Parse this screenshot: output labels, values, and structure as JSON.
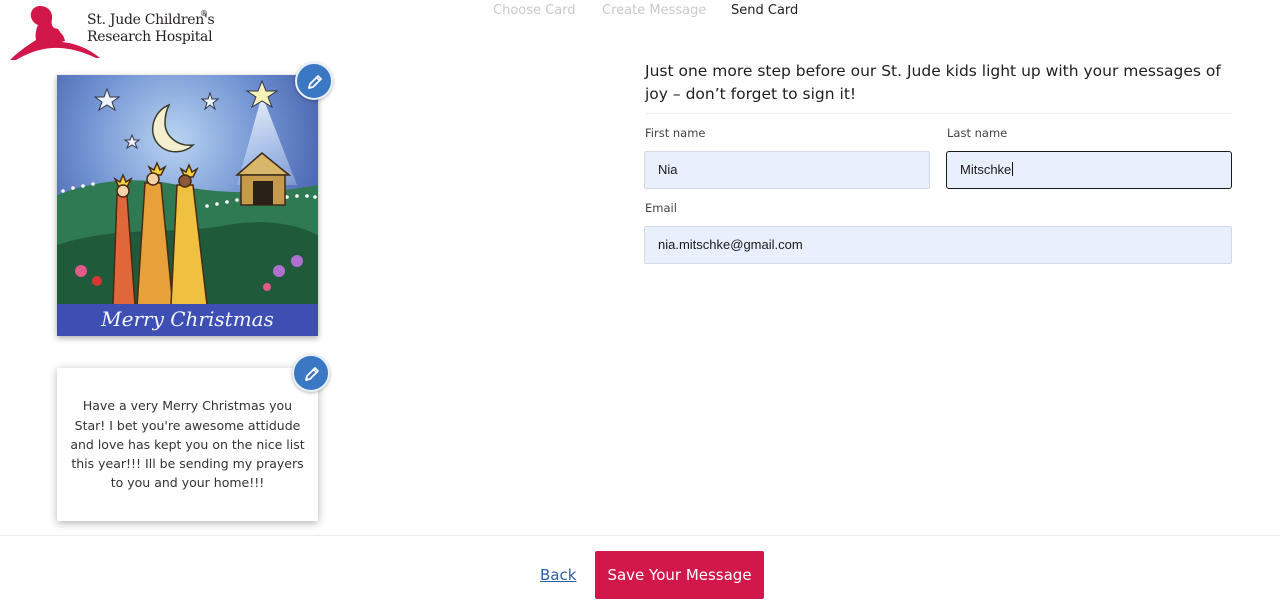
{
  "logo": {
    "line1": "St. Jude Children's",
    "line2": "Research Hospital",
    "reg": "®"
  },
  "steps": [
    "Choose Card",
    "Create Message",
    "Send Card"
  ],
  "active_step": "Send Card",
  "card": {
    "caption": "Merry Christmas"
  },
  "message": "Have a very Merry Christmas you Star! I bet you're awesome attidude and love has kept you on the nice list this year!!!  Ill be sending my prayers to you and your home!!!",
  "form": {
    "heading": "Just one more step before our St. Jude kids light up with your messages of joy – don’t forget to sign it!",
    "first_name_label": "First name",
    "first_name_value": "Nia",
    "last_name_label": "Last name",
    "last_name_value": "Mitschke",
    "email_label": "Email",
    "email_value": "nia.mitschke@gmail.com"
  },
  "footer": {
    "back_label": "Back",
    "save_label": "Save Your Message"
  },
  "colors": {
    "primary": "#d2174a",
    "edit_button": "#3a78c4",
    "input_bg": "#e8f0fe",
    "link": "#2c5fa8"
  },
  "icons": [
    "st-jude-logo-icon",
    "pencil-edit-icon"
  ]
}
